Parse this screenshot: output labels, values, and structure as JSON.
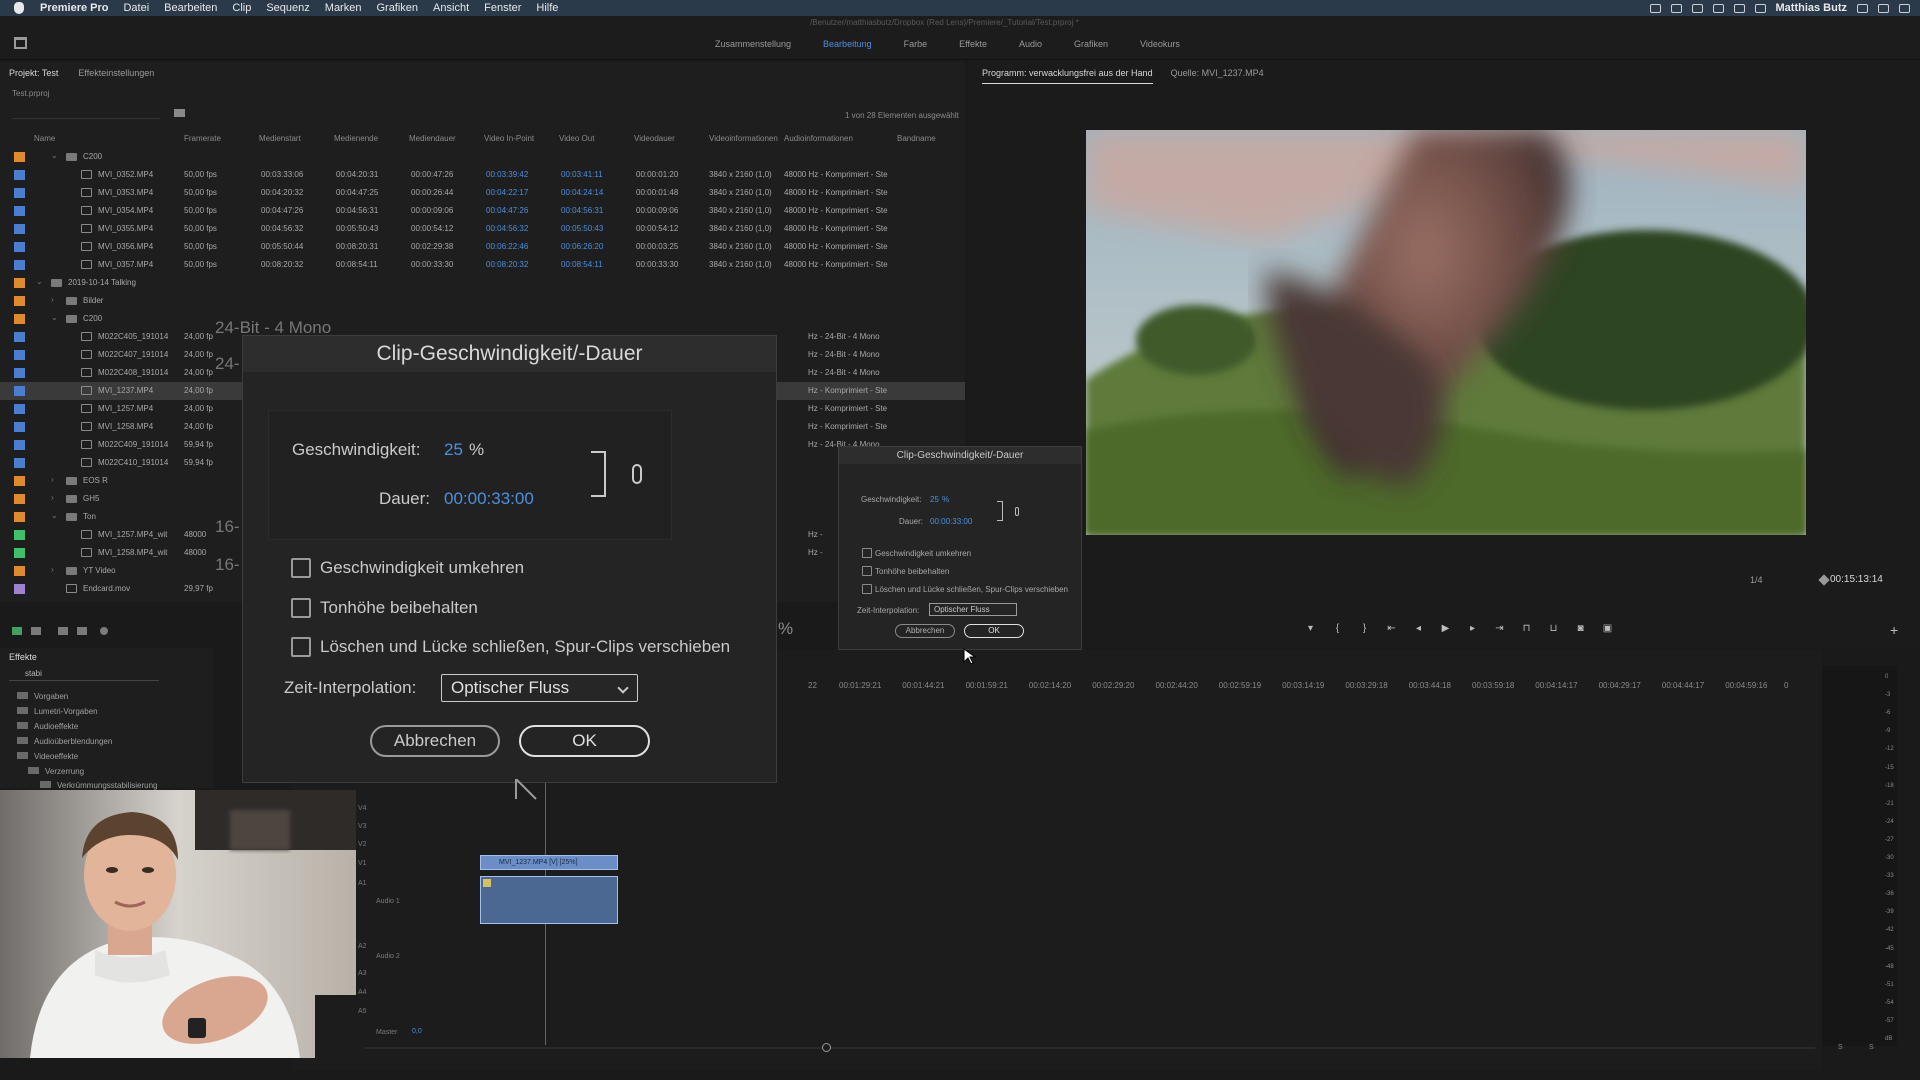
{
  "menubar": {
    "app": "Premiere Pro",
    "items": [
      "Datei",
      "Bearbeiten",
      "Clip",
      "Sequenz",
      "Marken",
      "Grafiken",
      "Ansicht",
      "Fenster",
      "Hilfe"
    ],
    "user": "Matthias Butz"
  },
  "titlebar": {
    "path": "/Benutzer/matthiasbutz/Dropbox (Red Lens)/Premiere/_Tutorial/Test.prproj *"
  },
  "workspaces": {
    "tabs": [
      "Zusammenstellung",
      "Bearbeitung",
      "Farbe",
      "Effekte",
      "Audio",
      "Grafiken",
      "Videokurs"
    ],
    "active": "Bearbeitung"
  },
  "project": {
    "tabs": [
      "Projekt: Test",
      "Effekteinstellungen"
    ],
    "file": "Test.prproj",
    "selection_count": "1 von 28 Elementen ausgewählt",
    "columns": [
      "Name",
      "Framerate",
      "Medienstart",
      "Medienende",
      "Mediendauer",
      "Video In-Point",
      "Video Out",
      "Videodauer",
      "Videoinformationen",
      "Audioinformationen",
      "Bandname"
    ],
    "rows": [
      {
        "type": "folder",
        "depth": 1,
        "name": "C200",
        "color": "#e08a2c"
      },
      {
        "type": "clip",
        "depth": 2,
        "name": "MVI_0352.MP4",
        "fps": "50,00 fps",
        "ms": "00:03:33:06",
        "me": "00:04:20:31",
        "md": "00:00:47:26",
        "vin": "00:03:39:42",
        "vout": "00:03:41:11",
        "vd": "00:00:01:20",
        "vinfo": "3840 x 2160 (1,0)",
        "ainfo": "48000 Hz - Komprimiert - Ste",
        "color": "#4a7ed0"
      },
      {
        "type": "clip",
        "depth": 2,
        "name": "MVI_0353.MP4",
        "fps": "50,00 fps",
        "ms": "00:04:20:32",
        "me": "00:04:47:25",
        "md": "00:00:26:44",
        "vin": "00:04:22:17",
        "vout": "00:04:24:14",
        "vd": "00:00:01:48",
        "vinfo": "3840 x 2160 (1,0)",
        "ainfo": "48000 Hz - Komprimiert - Ste",
        "color": "#4a7ed0"
      },
      {
        "type": "clip",
        "depth": 2,
        "name": "MVI_0354.MP4",
        "fps": "50,00 fps",
        "ms": "00:04:47:26",
        "me": "00:04:56:31",
        "md": "00:00:09:06",
        "vin": "00:04:47:26",
        "vout": "00:04:56:31",
        "vd": "00:00:09:06",
        "vinfo": "3840 x 2160 (1,0)",
        "ainfo": "48000 Hz - Komprimiert - Ste",
        "color": "#4a7ed0"
      },
      {
        "type": "clip",
        "depth": 2,
        "name": "MVI_0355.MP4",
        "fps": "50,00 fps",
        "ms": "00:04:56:32",
        "me": "00:05:50:43",
        "md": "00:00:54:12",
        "vin": "00:04:56:32",
        "vout": "00:05:50:43",
        "vd": "00:00:54:12",
        "vinfo": "3840 x 2160 (1,0)",
        "ainfo": "48000 Hz - Komprimiert - Ste",
        "color": "#4a7ed0"
      },
      {
        "type": "clip",
        "depth": 2,
        "name": "MVI_0356.MP4",
        "fps": "50,00 fps",
        "ms": "00:05:50:44",
        "me": "00:08:20:31",
        "md": "00:02:29:38",
        "vin": "00:06:22:46",
        "vout": "00:06:26:20",
        "vd": "00:00:03:25",
        "vinfo": "3840 x 2160 (1,0)",
        "ainfo": "48000 Hz - Komprimiert - Ste",
        "color": "#4a7ed0"
      },
      {
        "type": "clip",
        "depth": 2,
        "name": "MVI_0357.MP4",
        "fps": "50,00 fps",
        "ms": "00:08:20:32",
        "me": "00:08:54:11",
        "md": "00:00:33:30",
        "vin": "00:08:20:32",
        "vout": "00:08:54:11",
        "vd": "00:00:33:30",
        "vinfo": "3840 x 2160 (1,0)",
        "ainfo": "48000 Hz - Komprimiert - Ste",
        "color": "#4a7ed0"
      },
      {
        "type": "folder",
        "depth": 0,
        "name": "2019-10-14 Talking",
        "color": "#e08a2c"
      },
      {
        "type": "folder",
        "depth": 1,
        "name": "Bilder",
        "color": "#e08a2c",
        "collapsed": true
      },
      {
        "type": "folder",
        "depth": 1,
        "name": "C200",
        "color": "#e08a2c"
      },
      {
        "type": "clip",
        "depth": 2,
        "name": "M022C405_191014",
        "fps": "24,00 fp",
        "hz": "Hz - 24-Bit - 4 Mono",
        "color": "#4a7ed0"
      },
      {
        "type": "clip",
        "depth": 2,
        "name": "M022C407_191014",
        "fps": "24,00 fp",
        "hz": "Hz - 24-Bit - 4 Mono",
        "color": "#4a7ed0"
      },
      {
        "type": "clip",
        "depth": 2,
        "name": "M022C408_191014",
        "fps": "24,00 fp",
        "hz": "Hz - 24-Bit - 4 Mono",
        "color": "#4a7ed0"
      },
      {
        "type": "clip",
        "depth": 2,
        "name": "MVI_1237.MP4",
        "fps": "24,00 fp",
        "hz": "Hz - Komprimiert - Ste",
        "color": "#4a7ed0",
        "selected": true
      },
      {
        "type": "clip",
        "depth": 2,
        "name": "MVI_1257.MP4",
        "fps": "24,00 fp",
        "hz": "Hz - Komprimiert - Ste",
        "color": "#4a7ed0"
      },
      {
        "type": "clip",
        "depth": 2,
        "name": "MVI_1258.MP4",
        "fps": "24,00 fp",
        "hz": "Hz - Komprimiert - Ste",
        "color": "#4a7ed0"
      },
      {
        "type": "clip",
        "depth": 2,
        "name": "M022C409_191014",
        "fps": "59,94 fp",
        "hz": "Hz - 24-Bit - 4 Mono",
        "color": "#4a7ed0"
      },
      {
        "type": "clip",
        "depth": 2,
        "name": "M022C410_191014",
        "fps": "59,94 fp",
        "hz": "",
        "color": "#4a7ed0"
      },
      {
        "type": "folder",
        "depth": 1,
        "name": "EOS R",
        "color": "#e08a2c",
        "collapsed": true
      },
      {
        "type": "folder",
        "depth": 1,
        "name": "GH5",
        "color": "#e08a2c",
        "collapsed": true
      },
      {
        "type": "folder",
        "depth": 1,
        "name": "Ton",
        "color": "#e08a2c"
      },
      {
        "type": "clip",
        "depth": 2,
        "name": "MVI_1257.MP4_wit",
        "fps": "48000",
        "hz": "Hz -",
        "color": "#3fc06a"
      },
      {
        "type": "clip",
        "depth": 2,
        "name": "MVI_1258.MP4_wit",
        "fps": "48000",
        "hz": "Hz -",
        "color": "#3fc06a"
      },
      {
        "type": "folder",
        "depth": 1,
        "name": "YT Video",
        "color": "#e08a2c",
        "collapsed": true
      },
      {
        "type": "seq",
        "depth": 1,
        "name": "Endcard.mov",
        "fps": "29,97 fp",
        "color": "#a080d0"
      }
    ],
    "overlay_text": [
      "24-Bit - 4 Mono",
      "24-",
      "16-",
      "16-"
    ]
  },
  "effects": {
    "title": "Effekte",
    "search": "stabi",
    "items": [
      "Vorgaben",
      "Lumetri-Vorgaben",
      "Audioeffekte",
      "Audioüberblendungen",
      "Videoeffekte",
      "Verzerrung",
      "Verkrümmungsstabilisierung"
    ]
  },
  "program": {
    "tabs": [
      "Programm: verwacklungsfrei aus der Hand",
      "Quelle: MVI_1237.MP4"
    ],
    "fit": "1/4",
    "timecode": "00:15:13:14",
    "percent": "%"
  },
  "timeline": {
    "ruler": [
      "22",
      "00:01:29:21",
      "00:01:44:21",
      "00:01:59:21",
      "00:02:14:20",
      "00:02:29:20",
      "00:02:44:20",
      "00:02:59:19",
      "00:03:14:19",
      "00:03:29:18",
      "00:03:44:18",
      "00:03:59:18",
      "00:04:14:17",
      "00:04:29:17",
      "00:04:44:17",
      "00:04:59:16",
      "0"
    ],
    "tracks": [
      "V4",
      "V3",
      "V2",
      "V1",
      "A1",
      "Audio 1",
      "A2",
      "Audio 2",
      "A3",
      "A4",
      "A5",
      "Master"
    ],
    "master_value": "0,0",
    "clip_label": "MVI_1237.MP4 [V] [25%]",
    "meter_scale": [
      "0",
      "-3",
      "-6",
      "-9",
      "-12",
      "-15",
      "-18",
      "-21",
      "-24",
      "-27",
      "-30",
      "-33",
      "-36",
      "-39",
      "-42",
      "-45",
      "-48",
      "-51",
      "-54",
      "-57",
      "dB"
    ],
    "meter_bottom": [
      "S",
      "S"
    ]
  },
  "dialog": {
    "title": "Clip-Geschwindigkeit/-Dauer",
    "speed_label": "Geschwindigkeit:",
    "speed_value": "25",
    "speed_unit": "%",
    "duration_label": "Dauer:",
    "duration_value": "00:00:33:00",
    "checkboxes": [
      "Geschwindigkeit umkehren",
      "Tonhöhe beibehalten",
      "Löschen und Lücke schließen, Spur-Clips verschieben"
    ],
    "interp_label": "Zeit-Interpolation:",
    "interp_value": "Optischer Fluss",
    "cancel": "Abbrechen",
    "ok": "OK"
  }
}
